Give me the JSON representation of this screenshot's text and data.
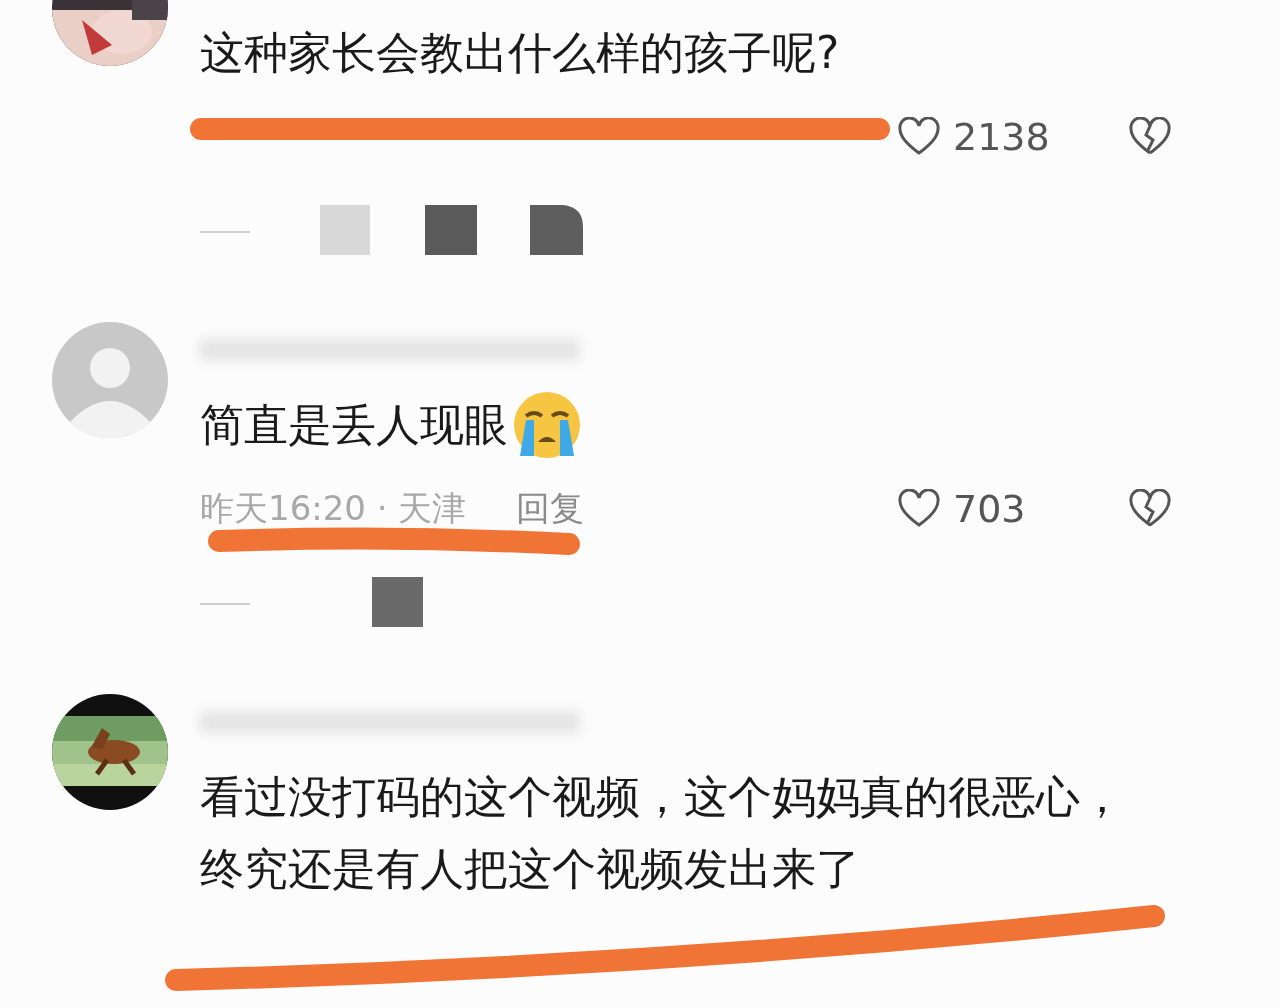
{
  "comments": [
    {
      "body": "这种家长会教出什么样的孩子呢?",
      "likes": "2138",
      "replies_redacted": true
    },
    {
      "avatar": {
        "kind": "default"
      },
      "body": "简直是丢人现眼",
      "emoji": {
        "kind": "crying"
      },
      "meta": "昨天16:20 · 天津",
      "reply": "回复",
      "likes": "703",
      "replies_redacted": true
    },
    {
      "body": "看过没打码的这个视频，这个妈妈真的很恶心，终究还是有人把这个视频发出来了",
      "replies_redacted": false
    }
  ]
}
